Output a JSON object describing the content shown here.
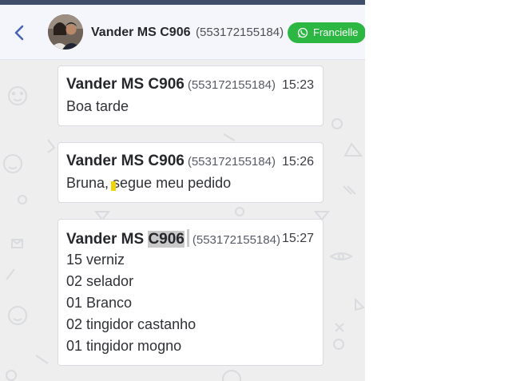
{
  "header": {
    "back_icon": "chevron-left-icon",
    "contact_name": "Vander MS C906",
    "contact_phone": "(553172155184)",
    "connection_label": "Francielle",
    "connection_icon": "whatsapp-icon"
  },
  "colors": {
    "chip_green": "#2bb741",
    "topbar": "#3f4f6a",
    "chat_bg": "#eeeeef",
    "selection_highlight": "#c9c9c9"
  },
  "messages": [
    {
      "author": "Vander MS C906",
      "phone": "(553172155184)",
      "time": "15:23",
      "lines": [
        "Boa tarde"
      ]
    },
    {
      "author": "Vander MS C906",
      "phone": "(553172155184)",
      "time": "15:26",
      "lines": [
        "Bruna, segue meu pedido"
      ]
    },
    {
      "author_prefix": "Vander MS",
      "author_selected": "C906",
      "phone": "(553172155184)",
      "time": "15:27",
      "lines": [
        "15 verniz",
        "02 selador",
        "01 Branco",
        "02 tingidor castanho",
        "01 tingidor mogno"
      ]
    }
  ]
}
